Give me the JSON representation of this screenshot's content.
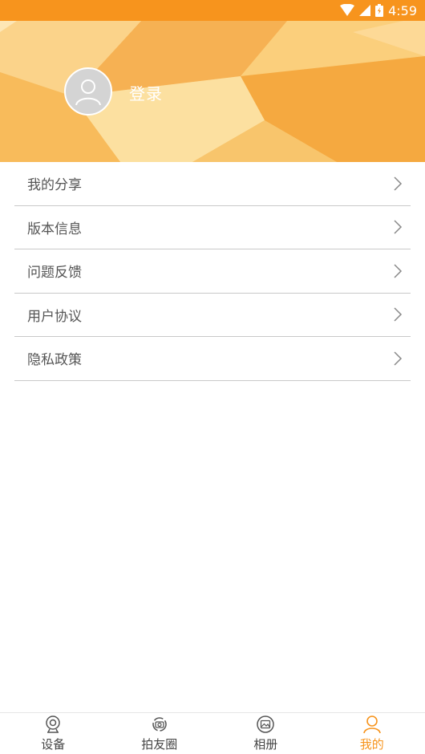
{
  "status_bar": {
    "time": "4:59",
    "color": "#f7941d"
  },
  "header": {
    "login_label": "登录"
  },
  "menu": {
    "items": [
      {
        "label": "我的分享",
        "icon": "chevron-right-icon"
      },
      {
        "label": "版本信息",
        "icon": "chevron-right-icon"
      },
      {
        "label": "问题反馈",
        "icon": "chevron-right-icon"
      },
      {
        "label": "用户协议",
        "icon": "chevron-right-icon"
      },
      {
        "label": "隐私政策",
        "icon": "chevron-right-icon"
      }
    ]
  },
  "tabbar": {
    "tabs": [
      {
        "label": "设备",
        "icon": "camera-icon",
        "active": false
      },
      {
        "label": "拍友圈",
        "icon": "friends-circle-icon",
        "active": false
      },
      {
        "label": "相册",
        "icon": "album-icon",
        "active": false
      },
      {
        "label": "我的",
        "icon": "user-icon",
        "active": true
      }
    ],
    "active_color": "#f7941d"
  }
}
